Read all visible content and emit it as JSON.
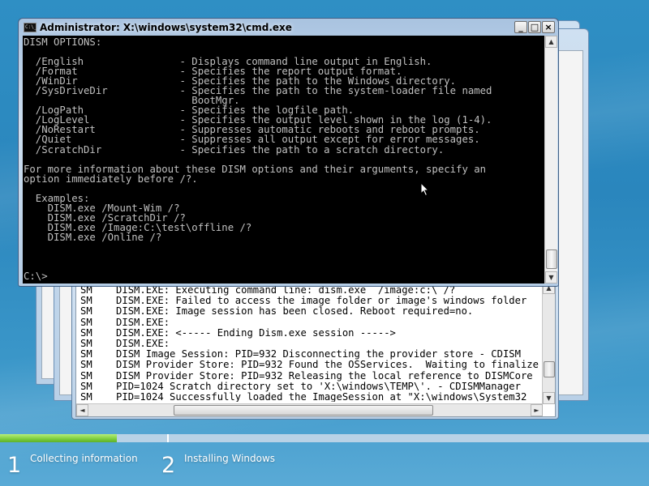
{
  "cmd_window": {
    "title": "Administrator: X:\\windows\\system32\\cmd.exe",
    "icon_text": "C:\\_",
    "minimize_label": "_",
    "maximize_label": "□",
    "close_label": "×",
    "console_lines": [
      "DISM OPTIONS:",
      "",
      "  /English                - Displays command line output in English.",
      "  /Format                 - Specifies the report output format.",
      "  /WinDir                 - Specifies the path to the Windows directory.",
      "  /SysDriveDir            - Specifies the path to the system-loader file named",
      "                            BootMgr.",
      "  /LogPath                - Specifies the logfile path.",
      "  /LogLevel               - Specifies the output level shown in the log (1-4).",
      "  /NoRestart              - Suppresses automatic reboots and reboot prompts.",
      "  /Quiet                  - Suppresses all output except for error messages.",
      "  /ScratchDir             - Specifies the path to a scratch directory.",
      "",
      "For more information about these DISM options and their arguments, specify an",
      "option immediately before /?.",
      "",
      "  Examples:",
      "    DISM.exe /Mount-Wim /?",
      "    DISM.exe /ScratchDir /?",
      "    DISM.exe /Image:C:\\test\\offline /?",
      "    DISM.exe /Online /?",
      "",
      "",
      "",
      "C:\\>"
    ]
  },
  "log_window": {
    "lines": [
      "SM    DISM.EXE: Executing command line: dism.exe  /image:c:\\ /?",
      "SM    DISM.EXE: Failed to access the image folder or image's windows folder",
      "SM    DISM.EXE: Image session has been closed. Reboot required=no.",
      "SM    DISM.EXE:",
      "SM    DISM.EXE: <----- Ending Dism.exe session ----->",
      "SM    DISM.EXE:",
      "SM    DISM Image Session: PID=932 Disconnecting the provider store - CDISM",
      "SM    DISM Provider Store: PID=932 Found the OSServices.  Waiting to finalize",
      "SM    DISM Provider Store: PID=932 Releasing the local reference to DISMCore",
      "SM    PID=1024 Scratch directory set to 'X:\\windows\\TEMP\\'. - CDISMManager",
      "SM    PID=1024 Successfully loaded the ImageSession at \"X:\\windows\\System32"
    ],
    "scroll_up": "▲",
    "scroll_down": "▼",
    "scroll_left": "◄",
    "scroll_right": "►"
  },
  "setup": {
    "progress_fraction": 0.18,
    "steps": [
      {
        "number": "1",
        "label": "Collecting information"
      },
      {
        "number": "2",
        "label": "Installing Windows"
      }
    ]
  },
  "colors": {
    "console_bg": "#000000",
    "console_text": "#c0c0c0",
    "progress_green": "#7ccd3c",
    "desktop_blue": "#2f8fc4"
  },
  "icons": {
    "cursor": "arrow-cursor-icon",
    "app": "cmd-app-icon"
  }
}
